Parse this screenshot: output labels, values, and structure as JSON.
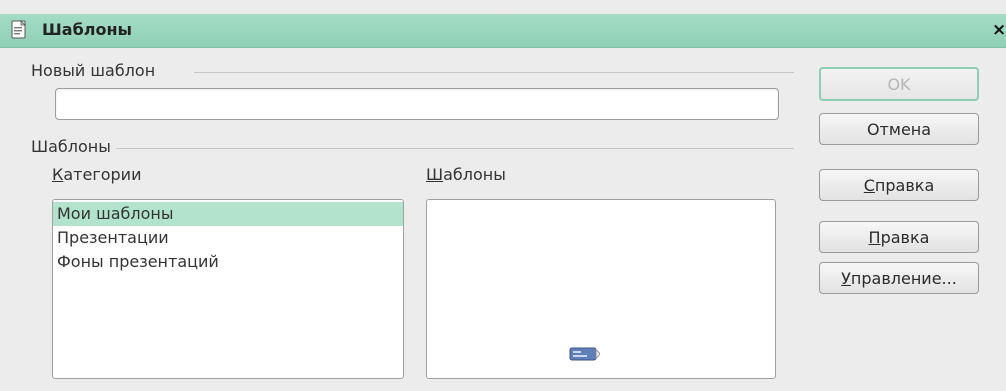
{
  "window": {
    "title": "Шаблоны",
    "close_glyph": "×"
  },
  "new_template": {
    "section_label": "Новый шаблон",
    "name_value": "",
    "name_placeholder": ""
  },
  "templates": {
    "section_label": "Шаблоны",
    "categories_label_accel": "К",
    "categories_label_rest": "атегории",
    "templates_label_accel": "Ш",
    "templates_label_rest": "аблоны",
    "categories": [
      {
        "label": "Мои шаблоны",
        "selected": true
      },
      {
        "label": "Презентации",
        "selected": false
      },
      {
        "label": "Фоны презентаций",
        "selected": false
      }
    ],
    "template_items": []
  },
  "buttons": {
    "ok": "OK",
    "cancel": "Отмена",
    "help_accel": "С",
    "help_rest": "правка",
    "edit_accel": "П",
    "edit_rest": "равка",
    "organize_accel": "У",
    "organize_rest": "правление..."
  },
  "icons": {
    "title": "template-document-icon",
    "preview": "presentation-preview-icon"
  },
  "colors": {
    "titlebar": "#9fd8c2",
    "selection": "#b2e3cd",
    "default_button_border": "#8ccfb4",
    "dialog_bg": "#ececec"
  }
}
